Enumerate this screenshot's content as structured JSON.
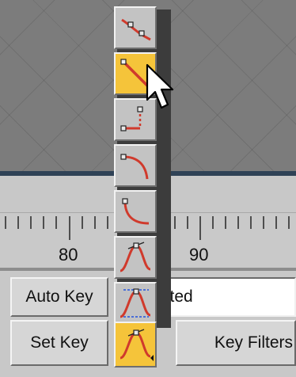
{
  "viewport": {
    "label": "perspective viewport grid"
  },
  "timeline": {
    "ruler_labels": [
      "80",
      "90"
    ]
  },
  "controls": {
    "auto_key_label": "Auto Key",
    "selection_value": "cted",
    "set_key_label": "Set Key",
    "key_filters_label": "Key Filters"
  },
  "tangent_flyout": {
    "options": [
      {
        "name": "Smooth",
        "icon": "smooth-tangent-icon",
        "active": false
      },
      {
        "name": "Linear",
        "icon": "linear-tangent-icon",
        "active": true
      },
      {
        "name": "Step",
        "icon": "step-tangent-icon",
        "active": false
      },
      {
        "name": "Slow",
        "icon": "slow-tangent-icon",
        "active": false
      },
      {
        "name": "Fast",
        "icon": "fast-tangent-icon",
        "active": false
      },
      {
        "name": "Custom",
        "icon": "custom-tangent-icon",
        "active": false
      },
      {
        "name": "Auto",
        "icon": "auto-tangent-icon",
        "active": false
      }
    ],
    "accent": "#f5c43a",
    "curve_color": "#d03a2c"
  }
}
